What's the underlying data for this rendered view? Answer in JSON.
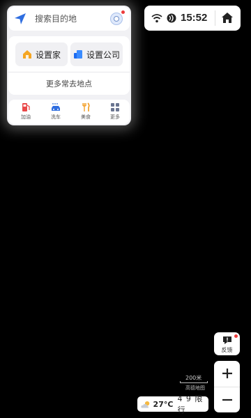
{
  "search": {
    "placeholder": "搜索目的地"
  },
  "places": {
    "home_label": "设置家",
    "company_label": "设置公司",
    "more_label": "更多常去地点"
  },
  "services": [
    {
      "label": "加油",
      "icon": "gas-station-icon",
      "color": "#e94848"
    },
    {
      "label": "洗车",
      "icon": "car-wash-icon",
      "color": "#2f6ee0"
    },
    {
      "label": "美食",
      "icon": "fork-knife-icon",
      "color": "#f29a1c"
    },
    {
      "label": "更多",
      "icon": "grid-icon",
      "color": "#6a7590"
    }
  ],
  "status": {
    "time": "15:52"
  },
  "feedback": {
    "label": "反馈"
  },
  "scale": {
    "distance": "200米",
    "sub": "高德地图"
  },
  "weather": {
    "temp": "27°C",
    "restriction": "4 9 限行"
  },
  "colors": {
    "accent": "#2f6ee0",
    "home": "#f5a623",
    "company": "#2f7df6",
    "badge": "#ec3b3b"
  }
}
